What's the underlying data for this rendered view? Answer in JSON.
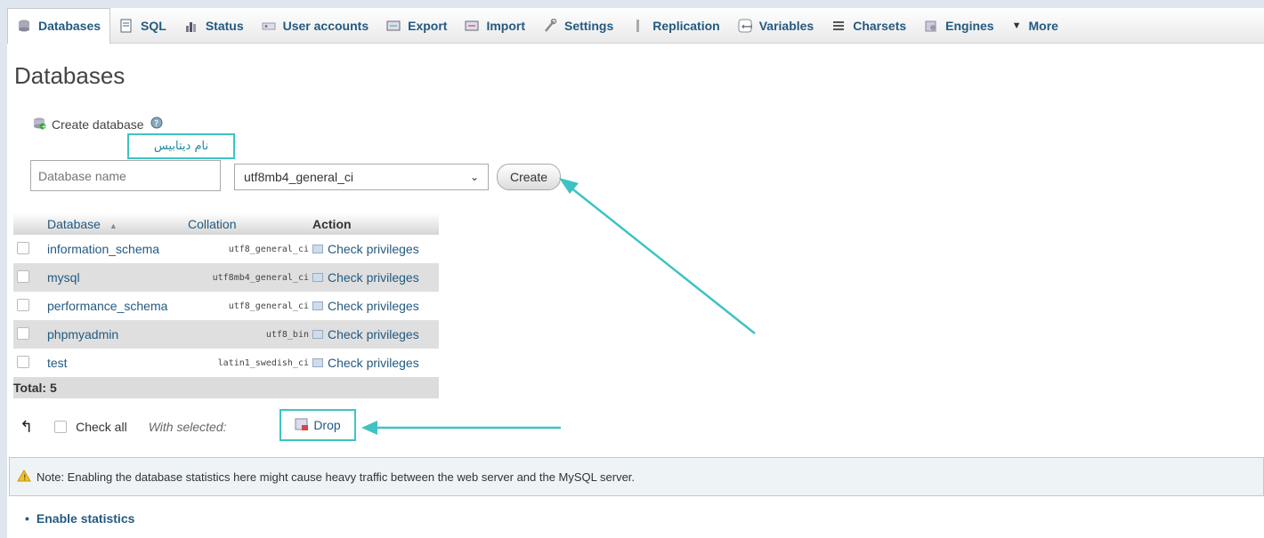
{
  "tabs": [
    {
      "label": "Databases",
      "icon": "database-icon",
      "active": true
    },
    {
      "label": "SQL",
      "icon": "sql-icon"
    },
    {
      "label": "Status",
      "icon": "status-icon"
    },
    {
      "label": "User accounts",
      "icon": "users-icon"
    },
    {
      "label": "Export",
      "icon": "export-icon"
    },
    {
      "label": "Import",
      "icon": "import-icon"
    },
    {
      "label": "Settings",
      "icon": "wrench-icon"
    },
    {
      "label": "Replication",
      "icon": "replication-icon"
    },
    {
      "label": "Variables",
      "icon": "variables-icon"
    },
    {
      "label": "Charsets",
      "icon": "charsets-icon"
    },
    {
      "label": "Engines",
      "icon": "engines-icon"
    },
    {
      "label": "More",
      "icon": "caret-down-icon"
    }
  ],
  "page": {
    "title": "Databases"
  },
  "create": {
    "heading": "Create database",
    "annotation": "نام دیتابیس",
    "db_name_placeholder": "Database name",
    "collation_value": "utf8mb4_general_ci",
    "create_label": "Create"
  },
  "table": {
    "headers": {
      "database": "Database",
      "collation": "Collation",
      "action": "Action"
    },
    "rows": [
      {
        "name": "information_schema",
        "collation": "utf8_general_ci",
        "action": "Check privileges"
      },
      {
        "name": "mysql",
        "collation": "utf8mb4_general_ci",
        "action": "Check privileges"
      },
      {
        "name": "performance_schema",
        "collation": "utf8_general_ci",
        "action": "Check privileges"
      },
      {
        "name": "phpmyadmin",
        "collation": "utf8_bin",
        "action": "Check privileges"
      },
      {
        "name": "test",
        "collation": "latin1_swedish_ci",
        "action": "Check privileges"
      }
    ],
    "total": "Total: 5"
  },
  "bulk": {
    "check_all": "Check all",
    "with_selected": "With selected:",
    "drop": "Drop"
  },
  "note": {
    "text": "Note: Enabling the database statistics here might cause heavy traffic between the web server and the MySQL server."
  },
  "enable_statistics": "Enable statistics",
  "colors": {
    "link": "#235a81",
    "annotation": "#3ec3c3"
  }
}
